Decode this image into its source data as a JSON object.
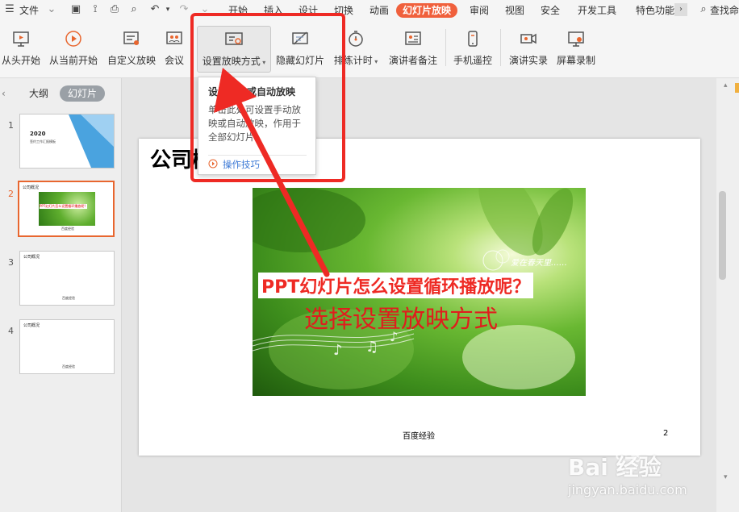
{
  "menubar": {
    "file_label": "文件",
    "items": [
      "开始",
      "插入",
      "设计",
      "切换",
      "动画",
      "幻灯片放映",
      "审阅",
      "视图",
      "安全",
      "开发工具",
      "特色功能"
    ],
    "search_label": "查找命"
  },
  "ribbon": {
    "buttons": [
      "从头开始",
      "从当前开始",
      "自定义放映",
      "会议",
      "设置放映方式",
      "隐藏幻灯片",
      "排练计时",
      "演讲者备注",
      "手机遥控",
      "演讲实录",
      "屏幕录制"
    ]
  },
  "tooltip": {
    "title": "设置手动或自动放映",
    "body": "单击此处可设置手动放映或自动放映，作用于全部幻灯片。",
    "link": "操作技巧"
  },
  "left_pane": {
    "tab_outline": "大纲",
    "tab_slides": "幻灯片",
    "slides": [
      {
        "num": "1",
        "title": "2020",
        "subtitle": "签约工作汇报模板"
      },
      {
        "num": "2",
        "title": "公司概况",
        "caption": "PPT幻灯片怎么设置循环播放呢？",
        "footer": "百度经验"
      },
      {
        "num": "3",
        "title": "公司概况",
        "footer": "百度经验"
      },
      {
        "num": "4",
        "title": "公司概况",
        "footer": "百度经验"
      }
    ]
  },
  "slide": {
    "title": "公司概况",
    "image_overlay_text": "爱在春天里……",
    "caption_question": "PPT幻灯片怎么设置循环播放呢？",
    "caption_instruction": "选择设置放映方式",
    "footer": "百度经验",
    "page_number": "2"
  },
  "watermark": {
    "brand": "Bai 经验",
    "url": "jingyan.baidu.com"
  },
  "colors": {
    "accent": "#f0603c",
    "annotation_red": "#ee2a24",
    "selected_thumb": "#e8662f"
  }
}
